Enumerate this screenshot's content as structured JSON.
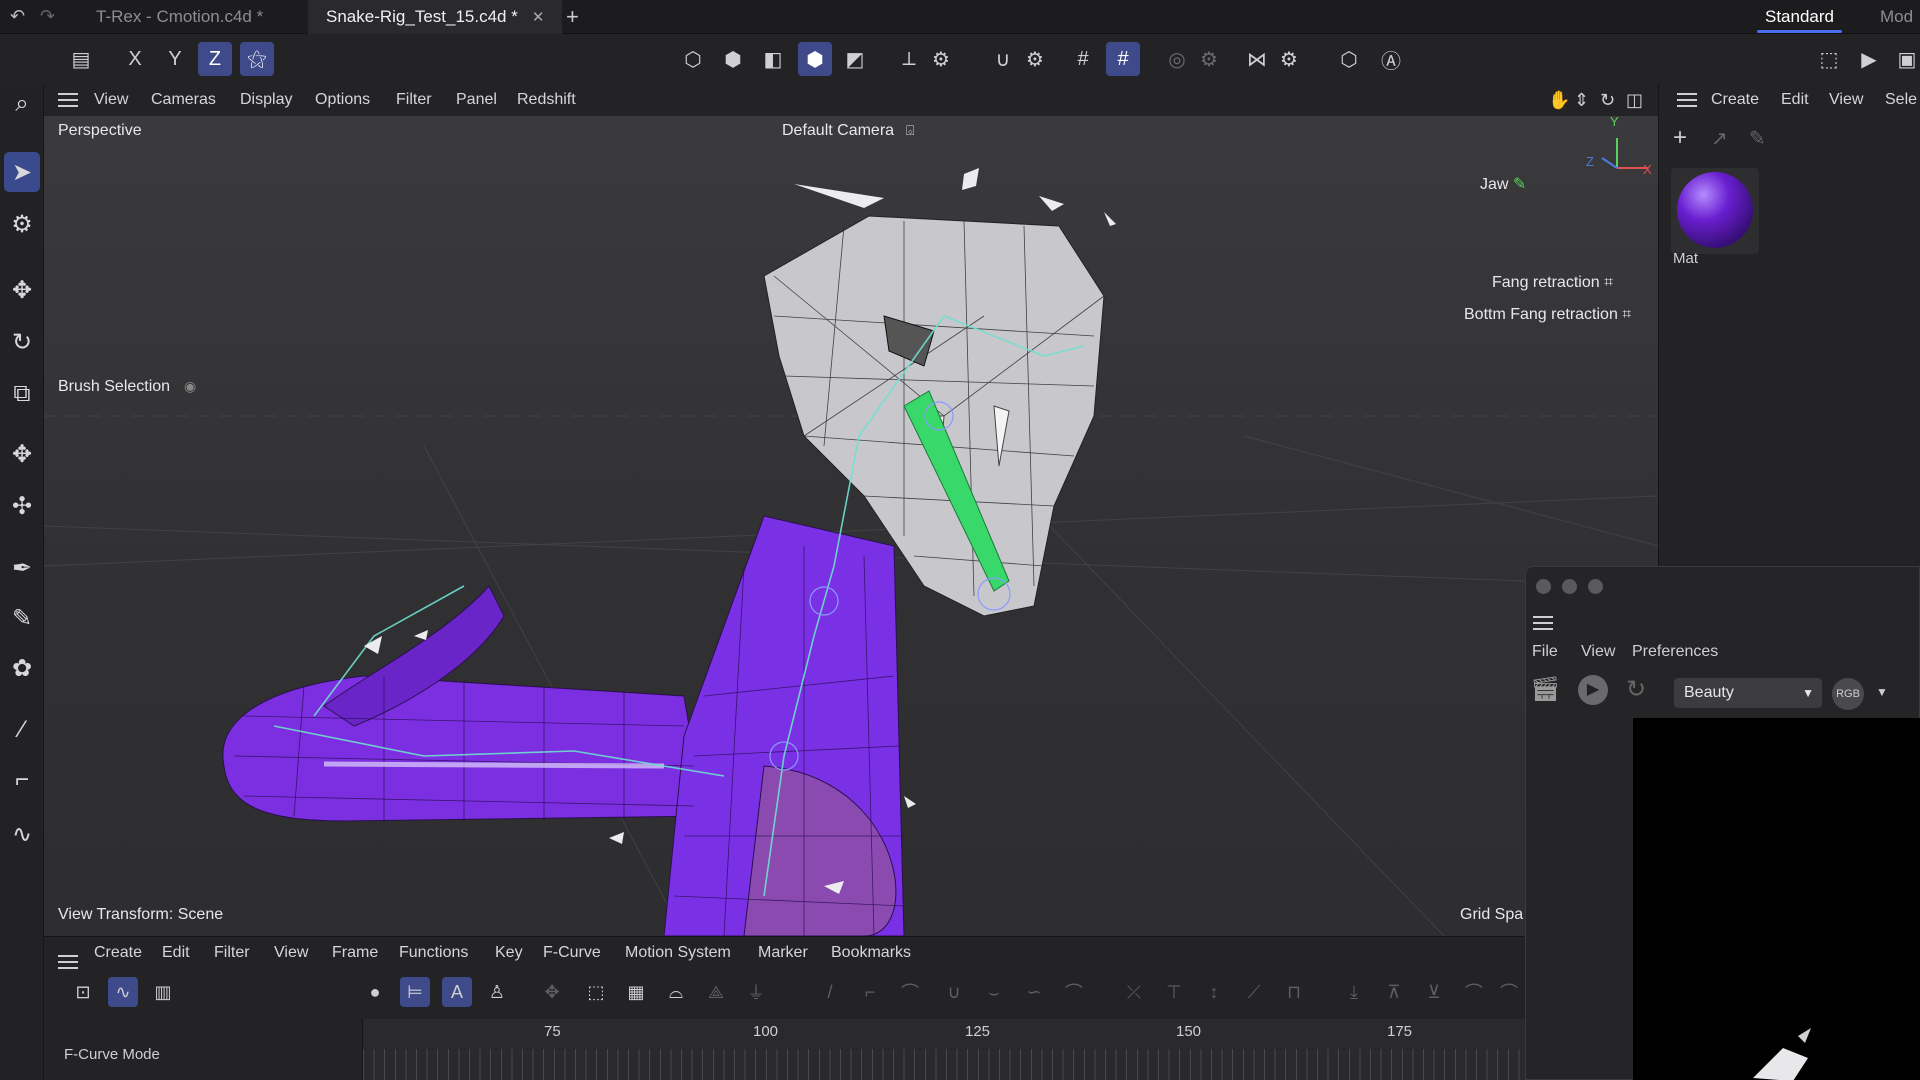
{
  "tabs": [
    {
      "label": "T-Rex - Cmotion.c4d *",
      "active": false
    },
    {
      "label": "Snake-Rig_Test_15.c4d *",
      "active": true
    }
  ],
  "layouts": {
    "active": "Standard",
    "next": "Mod"
  },
  "toolbar": {
    "axis_x": "X",
    "axis_y": "Y",
    "axis_z": "Z"
  },
  "viewport": {
    "menu": [
      "View",
      "Cameras",
      "Display",
      "Options",
      "Filter",
      "Panel",
      "Redshift"
    ],
    "projection": "Perspective",
    "camera": "Default Camera",
    "brush_selection": "Brush Selection",
    "view_transform": "View Transform: Scene",
    "grid_spacing": "Grid Spa",
    "controls": [
      "Jaw",
      "Fang retraction",
      "Bottm Fang retraction"
    ],
    "axis_labels": {
      "y": "Y",
      "z": "Z",
      "x": "X"
    }
  },
  "object_panel": {
    "menu": [
      "Create",
      "Edit",
      "View",
      "Sele"
    ],
    "material_name": "Mat",
    "material_color": "#6a1fd0"
  },
  "render_window": {
    "menu": [
      "File",
      "View",
      "Preferences"
    ],
    "pass": "Beauty",
    "rgb_label": "RGB"
  },
  "timeline": {
    "menu": [
      "Create",
      "Edit",
      "Filter",
      "View",
      "Frame",
      "Functions",
      "Key",
      "F-Curve",
      "Motion System",
      "Marker",
      "Bookmarks"
    ],
    "mode": "F-Curve Mode",
    "ruler": [
      "75",
      "100",
      "125",
      "150",
      "175"
    ]
  },
  "colors": {
    "accent": "#3f4a8a",
    "snake_body": "#7a2fe0",
    "bone": "#33d36a"
  }
}
